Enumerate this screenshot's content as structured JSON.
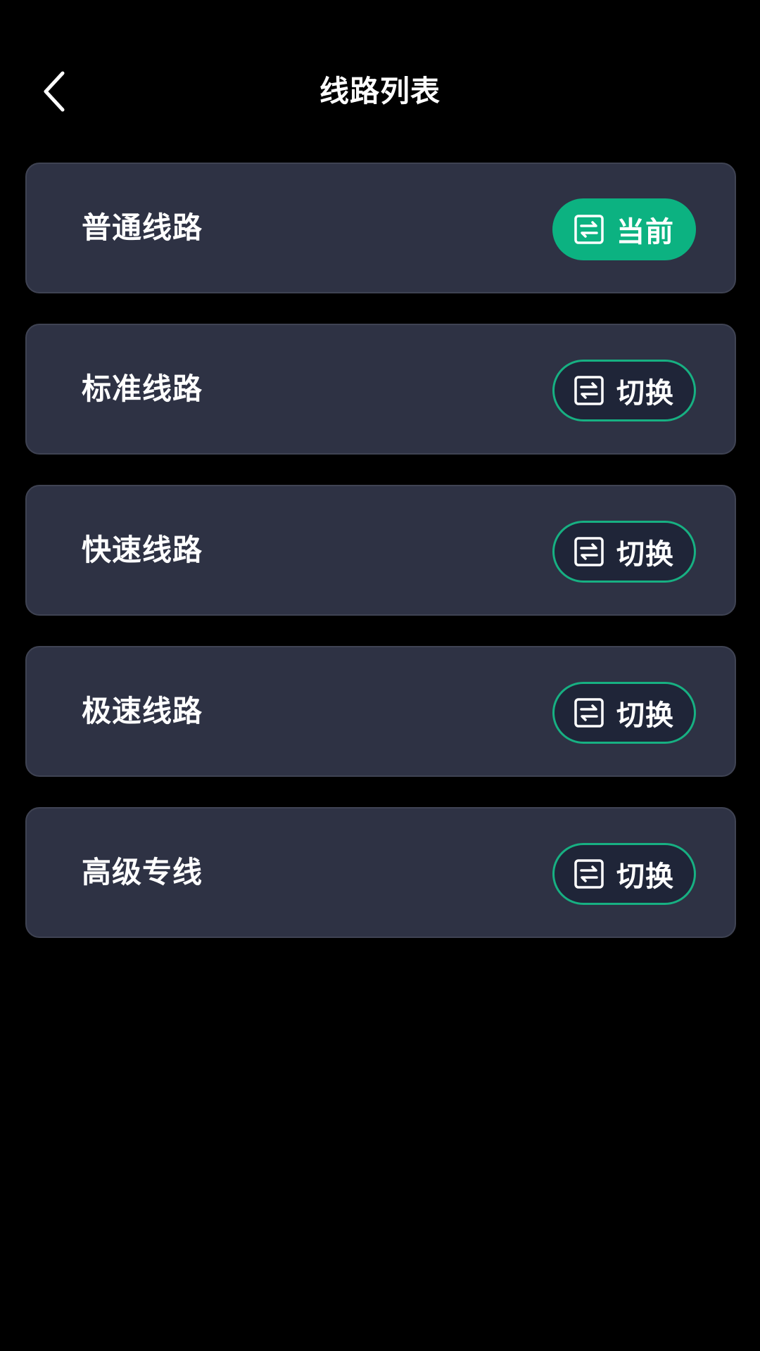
{
  "header": {
    "title": "线路列表",
    "back_icon": "chevron-left-icon"
  },
  "colors": {
    "background": "#000000",
    "card": "#2e3244",
    "accent": "#0cb281",
    "button_dark": "#1f2538"
  },
  "routes": [
    {
      "name": "普通线路",
      "button_label": "当前",
      "state": "current",
      "icon": "switch-icon"
    },
    {
      "name": "标准线路",
      "button_label": "切换",
      "state": "switch",
      "icon": "switch-icon"
    },
    {
      "name": "快速线路",
      "button_label": "切换",
      "state": "switch",
      "icon": "switch-icon"
    },
    {
      "name": "极速线路",
      "button_label": "切换",
      "state": "switch",
      "icon": "switch-icon"
    },
    {
      "name": "高级专线",
      "button_label": "切换",
      "state": "switch",
      "icon": "switch-icon"
    }
  ]
}
